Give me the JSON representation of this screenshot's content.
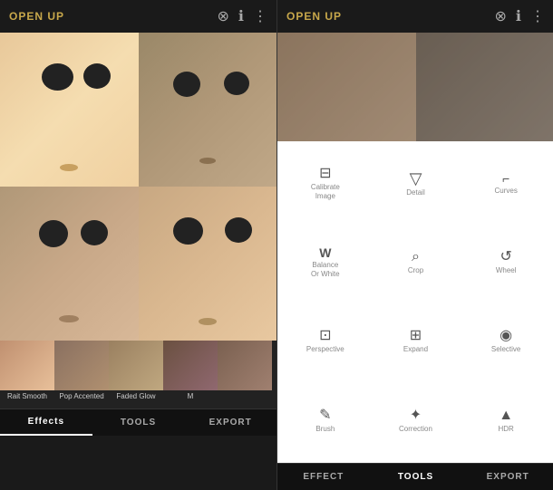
{
  "app": {
    "title": "OPEN UP"
  },
  "left_panel": {
    "top_icons": [
      "layers-icon",
      "info-icon",
      "more-icon"
    ],
    "bottom_tabs": [
      {
        "label": "Effects",
        "active": true
      },
      {
        "label": "TOOLS",
        "active": false
      },
      {
        "label": "EXPORT",
        "active": false
      }
    ],
    "thumbnails": [
      {
        "label": "Rait Smooth"
      },
      {
        "label": "Pop Accented"
      },
      {
        "label": "Faded Glow"
      },
      {
        "label": "M"
      }
    ]
  },
  "right_panel": {
    "top_icons": [
      "layers-icon",
      "info-icon",
      "more-icon"
    ],
    "tools": [
      {
        "icon": "⊟",
        "label": "Calibrate\nImage",
        "name": "calibrate"
      },
      {
        "icon": "▽",
        "label": "Detail",
        "name": "detail"
      },
      {
        "icon": "⌐",
        "label": "Curves",
        "name": "curves"
      },
      {
        "icon": "W",
        "label": "Balance\nOr White",
        "name": "balance-or-white"
      },
      {
        "icon": "⌕",
        "label": "Crop",
        "name": "crop"
      },
      {
        "icon": "↺",
        "label": "Wheel",
        "name": "wheel"
      },
      {
        "icon": "⊡",
        "label": "Perspective",
        "name": "perspective"
      },
      {
        "icon": "⊞",
        "label": "Expand",
        "name": "expand"
      },
      {
        "icon": "◉",
        "label": "Selective",
        "name": "selective"
      },
      {
        "icon": "✎",
        "label": "Brush",
        "name": "brush"
      },
      {
        "icon": "✦",
        "label": "Correction",
        "name": "correction"
      },
      {
        "icon": "▲",
        "label": "HDR",
        "name": "hdr"
      }
    ],
    "bottom_tabs": [
      {
        "label": "EFFECT",
        "active": false
      },
      {
        "label": "TOOLS",
        "active": true
      },
      {
        "label": "EXPORT",
        "active": false
      }
    ]
  }
}
